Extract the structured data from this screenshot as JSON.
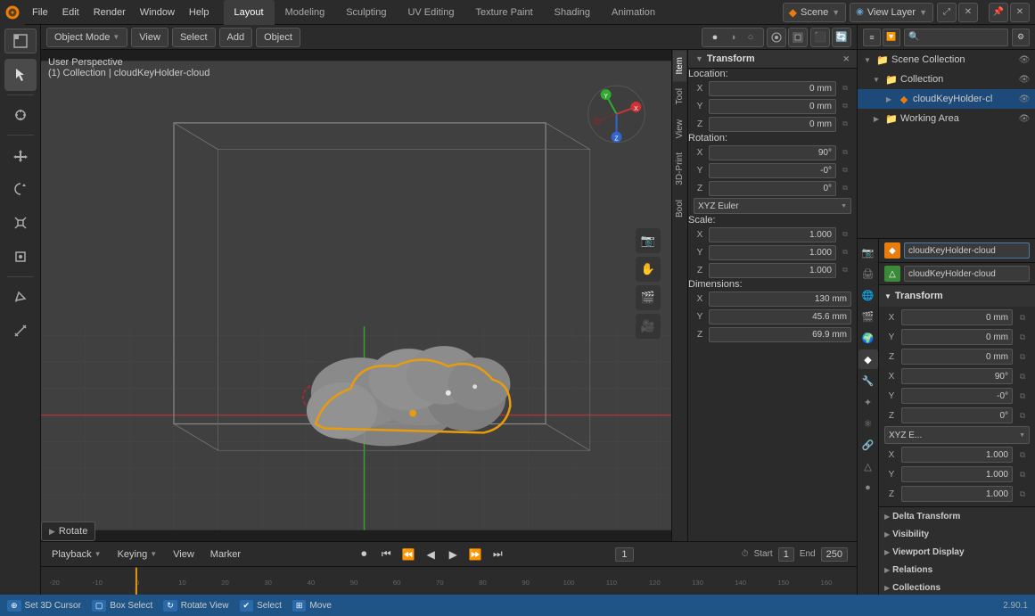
{
  "topMenu": {
    "items": [
      "File",
      "Edit",
      "Render",
      "Window",
      "Help"
    ],
    "workspaceTabs": [
      "Layout",
      "Modeling",
      "Sculpting",
      "UV Editing",
      "Texture Paint",
      "Shading",
      "Animation"
    ],
    "activeTab": "Layout"
  },
  "viewport": {
    "mode": "Object Mode",
    "viewMenuItems": [
      "View",
      "Select",
      "Add",
      "Object"
    ],
    "info": "User Perspective",
    "collectionInfo": "(1) Collection | cloudKeyHolder-cloud",
    "rotateBadge": "Rotate"
  },
  "scene": {
    "name": "Scene"
  },
  "viewLayer": {
    "title": "View Layer",
    "sceneCollection": "Scene Collection",
    "collection": "Collection",
    "object": "cloudKeyHolder-cl",
    "workingArea": "Working Area"
  },
  "transform": {
    "title": "Transform",
    "location": {
      "x": "0 mm",
      "y": "0 mm",
      "z": "0 mm"
    },
    "rotation": {
      "x": "90°",
      "y": "-0°",
      "z": "0°"
    },
    "rotationMode": "XYZ Euler",
    "scale": {
      "x": "1.000",
      "y": "1.000",
      "z": "1.000"
    },
    "dimensions": {
      "x": "130 mm",
      "y": "45.6 mm",
      "z": "69.9 mm"
    }
  },
  "propertiesPanel": {
    "objectName": "cloudKeyHolder-cloud",
    "meshName": "cloudKeyHolder-cloud",
    "transform": {
      "location": {
        "x": "0 mm",
        "y": "0 mm",
        "z": "0 mm"
      },
      "rotation": {
        "x": "90°",
        "y": "-0°",
        "z": "0°"
      },
      "rotationMode": "XYZ E...",
      "scale": {
        "x": "1.000",
        "y": "1.000",
        "z": "1.000"
      }
    },
    "sections": [
      "Delta Transform",
      "Visibility",
      "Viewport Display",
      "Relations",
      "Collections"
    ]
  },
  "timeline": {
    "playback": "Playback",
    "keying": "Keying",
    "view": "View",
    "marker": "Marker",
    "currentFrame": "1",
    "startFrame": "1",
    "endFrame": "250"
  },
  "statusBar": {
    "cursor": "Set 3D Cursor",
    "boxSelect": "Box Select",
    "rotateView": "Rotate View",
    "select": "Select",
    "move": "Move",
    "version": "2.90.1"
  }
}
